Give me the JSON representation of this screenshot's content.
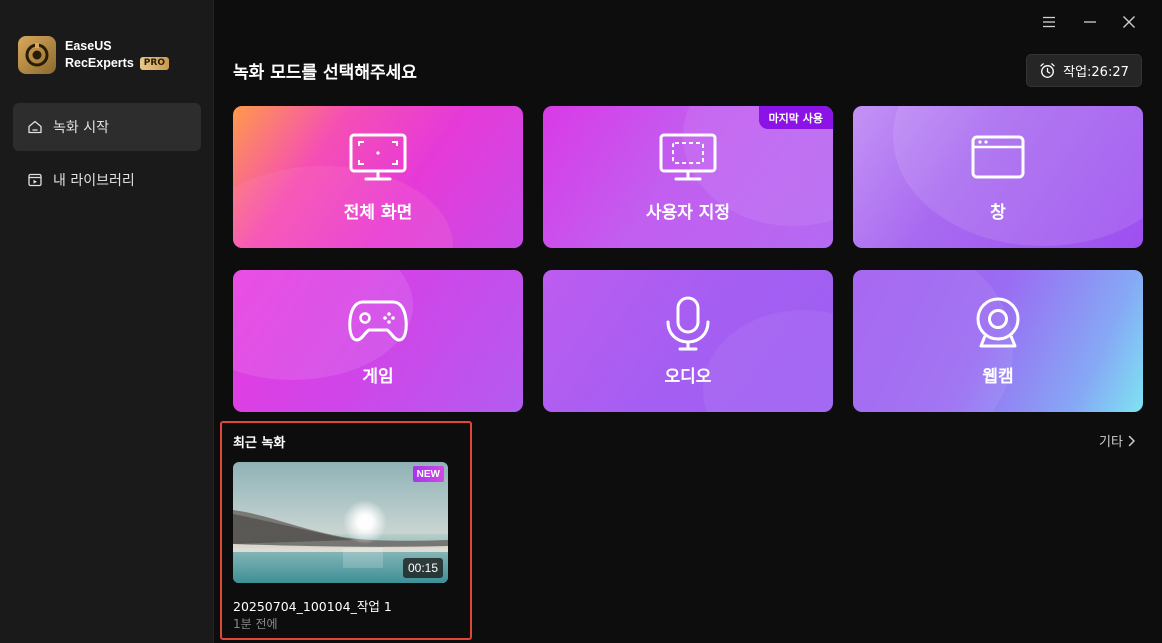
{
  "app": {
    "brand_line1": "EaseUS",
    "brand_line2": "RecExperts",
    "pro_badge": "PRO"
  },
  "sidebar": {
    "items": [
      {
        "label": "녹화 시작",
        "icon": "home-icon",
        "active": true
      },
      {
        "label": "내 라이브러리",
        "icon": "library-icon",
        "active": false
      }
    ]
  },
  "window_controls": [
    "menu-icon",
    "minimize-icon",
    "close-icon"
  ],
  "header": {
    "title": "녹화 모드를 선택해주세요",
    "timer_label": "작업:26:27"
  },
  "modes": [
    {
      "label": "전체 화면",
      "icon": "full-screen-icon"
    },
    {
      "label": "사용자 지정",
      "icon": "custom-region-icon",
      "badge": "마지막 사용"
    },
    {
      "label": "창",
      "icon": "window-icon"
    },
    {
      "label": "게임",
      "icon": "gamepad-icon"
    },
    {
      "label": "오디오",
      "icon": "microphone-icon"
    },
    {
      "label": "웹캠",
      "icon": "webcam-icon"
    }
  ],
  "recent": {
    "title": "최근 녹화",
    "more_label": "기타",
    "items": [
      {
        "badge": "NEW",
        "duration": "00:15",
        "name": "20250704_100104_작업 1",
        "time_ago": "1분 전에"
      }
    ]
  },
  "colors": {
    "accent_purple": "#8b13e6",
    "highlight_red": "#e0463a",
    "sidebar_bg": "#1a1a1a",
    "main_bg": "#0d0d0d"
  }
}
